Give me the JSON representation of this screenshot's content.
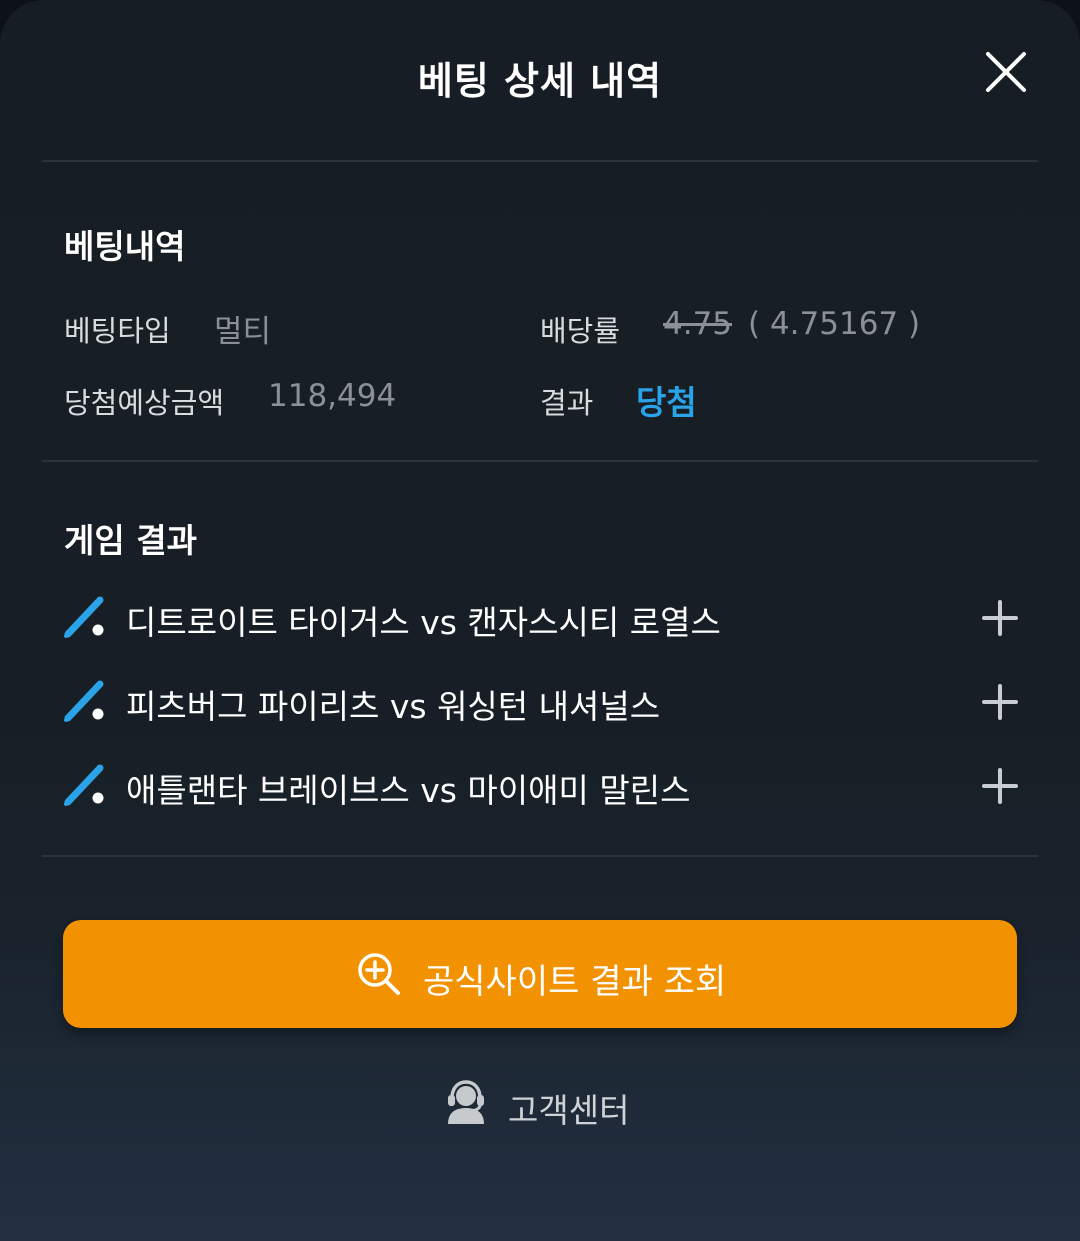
{
  "header": {
    "title": "베팅 상세 내역",
    "close_icon": "close-icon"
  },
  "bet_details": {
    "section_title": "베팅내역",
    "bet_type_label": "베팅타입",
    "bet_type_value": "멀티",
    "odds_label": "배당률",
    "odds_original": "4.75",
    "odds_actual": "( 4.75167 )",
    "expected_label": "당첨예상금액",
    "expected_value": "118,494",
    "result_label": "결과",
    "result_value": "당첨",
    "result_color": "#2aa3e8"
  },
  "game_results": {
    "section_title": "게임 결과",
    "games": [
      {
        "sport_icon": "baseball-bat-icon",
        "name": "디트로이트 타이거스 vs 캔자스시티 로열스",
        "expand_icon": "plus-icon"
      },
      {
        "sport_icon": "baseball-bat-icon",
        "name": "피츠버그 파이리츠 vs 워싱턴 내셔널스",
        "expand_icon": "plus-icon"
      },
      {
        "sport_icon": "baseball-bat-icon",
        "name": "애틀랜타 브레이브스 vs 마이애미 말린스",
        "expand_icon": "plus-icon"
      }
    ]
  },
  "actions": {
    "official_button_label": "공식사이트 결과 조회",
    "official_button_icon": "magnifier-plus-icon",
    "official_button_color": "#f39200",
    "support_label": "고객센터",
    "support_icon": "headset-agent-icon"
  }
}
